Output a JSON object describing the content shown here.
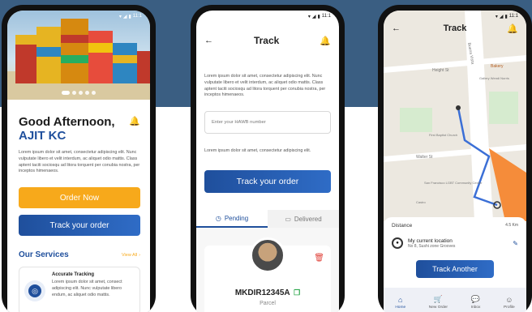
{
  "phone1": {
    "status": {
      "time": "11:1"
    },
    "greeting": "Good Afternoon,",
    "user_name": "AJIT KC",
    "intro_text": "Lorem ipsum dolor sit amet, consectetur adipiscing elit. Nunc vulputate libero et velit interdum, ac aliquet odio mattis. Class aptent taciti sociosqu ad litora torquent per conubia nostra, per inceptos himenaeos.",
    "order_now_label": "Order Now",
    "track_label": "Track your order",
    "services_title": "Our Services",
    "view_all_label": "View All",
    "service_card": {
      "title": "Accurate Tracking",
      "text": "Lorem ipsum dolor sit amet, consect adipiscing elit. Nunc vulputate libero endum, ac aliquet odio mattis."
    }
  },
  "phone2": {
    "status": {
      "time": "11:1"
    },
    "title": "Track",
    "text1": "Lorem ipsum dolor sit amet, consectetur adipiscing elit. Nunc vulputate libero et velit interdum, ac aliquet odio mattis. Class aptent taciti sociosqu ad litora torquent per conubia nostra, per inceptos himenaeos.",
    "hawb_placeholder": "Enter your HAWB number",
    "text2": "Lorem ipsum dolor sit amet, consectetur adipiscing elit.",
    "track_label": "Track your order",
    "tabs": [
      {
        "label": "Pending"
      },
      {
        "label": "Delivered"
      }
    ],
    "parcel": {
      "code": "MKDIR12345A",
      "type": "Parcel"
    }
  },
  "phone3": {
    "status": {
      "time": "11:1"
    },
    "title": "Track",
    "map_labels": {
      "height_st": "Height St",
      "buena_vista": "Buena Vista",
      "bakery": "Bakery",
      "gallery": "Gallery Wendi Norris",
      "first_baptist": "First Baptist Church",
      "walter_st": "Walter St",
      "lgbt_center": "San Francisco LGBT Community Center",
      "castro": "Castro"
    },
    "distance_label": "Distance",
    "distance_value": "4.5 Km",
    "location_title": "My current location",
    "location_address": "No 8, Sushi zone Grooves",
    "track_another_label": "Track Another",
    "nav": [
      {
        "label": "Home"
      },
      {
        "label": "New Order"
      },
      {
        "label": "Inbox"
      },
      {
        "label": "Profile"
      }
    ]
  },
  "colors": {
    "background_band": "#3a5e82",
    "primary": "#1f4f9c",
    "accent": "#f7a91b",
    "route": "#3b6fd6",
    "delete": "#e0433b"
  }
}
